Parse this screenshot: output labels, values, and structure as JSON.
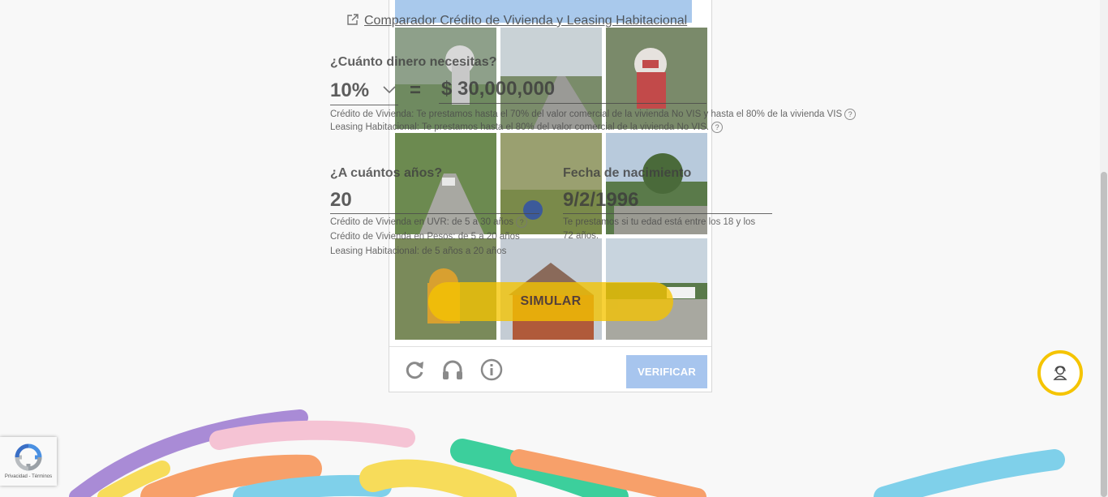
{
  "link": {
    "text": "Comparador Crédito de Vivienda y Leasing Habitacional"
  },
  "amount_section": {
    "question": "¿Cuánto dinero necesitas?",
    "percent_value": "10%",
    "equals": "=",
    "amount_value": "$ 30,000,000",
    "note_credito": "Crédito de Vivienda: Te prestamos hasta el 70% del valor comercial de la vivienda No VIS y hasta el 80% de la vivienda VIS",
    "note_leasing": "Leasing Habitacional: Te prestamos hasta el 80% del valor comercial de la vivienda No VIS."
  },
  "years_section": {
    "question": "¿A cuántos años?",
    "value": "20",
    "note_uvr": "Crédito de Vivienda en UVR: de 5 a 30 años",
    "note_pesos": "Crédito de Vivienda en Pesos: de 5 a 20 años",
    "note_leasing": "Leasing Habitacional: de 5 años a 20 años"
  },
  "birth_section": {
    "label": "Fecha de nacimiento",
    "value": "9/2/1996",
    "note": "Te prestamos si tu edad está entre los 18 y los 72 años."
  },
  "simulate_button": "SIMULAR",
  "captcha": {
    "verify_label": "VERIFICAR",
    "controls": [
      "reload-icon",
      "headphones-icon",
      "info-icon"
    ]
  },
  "recaptcha_badge": "Privacidad - Términos",
  "help_glyph": "?",
  "colors": {
    "accent_yellow": "#f5c400",
    "verify_blue": "#a7c5ee",
    "captcha_header": "#a9c9ec"
  }
}
